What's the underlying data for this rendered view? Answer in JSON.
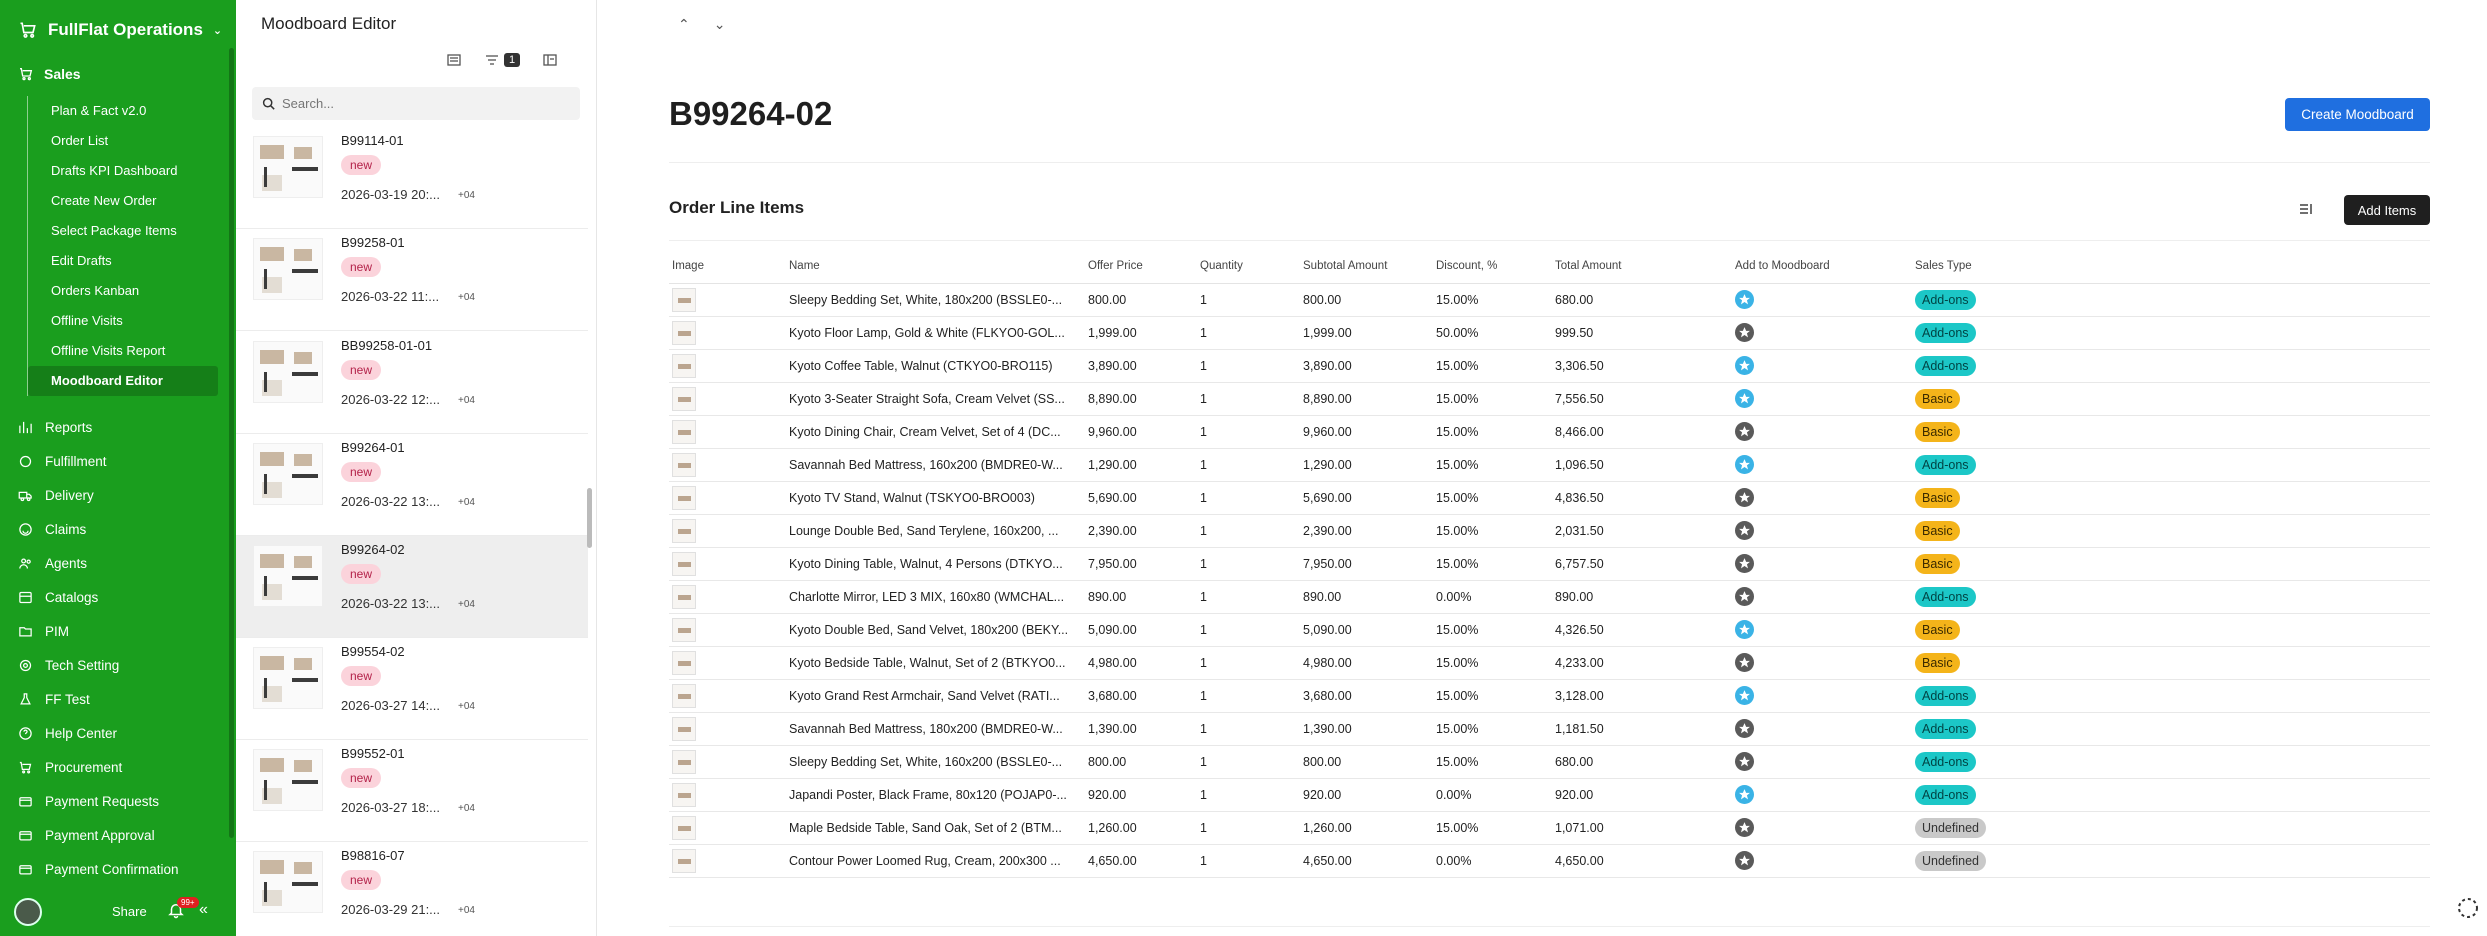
{
  "app": {
    "name": "FullFlat Operations",
    "section": "Sales",
    "share_label": "Share",
    "notif_count": "99+"
  },
  "sidebar": {
    "sales_items": [
      {
        "label": "Plan & Fact v2.0"
      },
      {
        "label": "Order List"
      },
      {
        "label": "Drafts KPI Dashboard"
      },
      {
        "label": "Create New Order"
      },
      {
        "label": "Select Package Items"
      },
      {
        "label": "Edit Drafts"
      },
      {
        "label": "Orders Kanban"
      },
      {
        "label": "Offline Visits"
      },
      {
        "label": "Offline Visits Report"
      },
      {
        "label": "Moodboard Editor"
      }
    ],
    "main_items": [
      {
        "label": "Reports",
        "icon": "chart-icon"
      },
      {
        "label": "Fulfillment",
        "icon": "circle-icon"
      },
      {
        "label": "Delivery",
        "icon": "truck-icon"
      },
      {
        "label": "Claims",
        "icon": "smile-icon"
      },
      {
        "label": "Agents",
        "icon": "users-icon"
      },
      {
        "label": "Catalogs",
        "icon": "grid-icon"
      },
      {
        "label": "PIM",
        "icon": "folder-icon"
      },
      {
        "label": "Tech Setting",
        "icon": "gear-icon"
      },
      {
        "label": "FF Test",
        "icon": "flask-icon"
      },
      {
        "label": "Help Center",
        "icon": "help-icon"
      },
      {
        "label": "Procurement",
        "icon": "cart-icon"
      },
      {
        "label": "Payment Requests",
        "icon": "payment-icon"
      },
      {
        "label": "Payment Approval",
        "icon": "payment-icon"
      },
      {
        "label": "Payment Confirmation",
        "icon": "payment-icon"
      }
    ]
  },
  "list_panel": {
    "title": "Moodboard Editor",
    "filter_count": "1",
    "search_placeholder": "Search...",
    "cards": [
      {
        "code": "B99114-01",
        "status": "new",
        "date": "2026-03-19 20:...",
        "tz": "+04"
      },
      {
        "code": "B99258-01",
        "status": "new",
        "date": "2026-03-22 11:...",
        "tz": "+04"
      },
      {
        "code": "BB99258-01-01",
        "status": "new",
        "date": "2026-03-22 12:...",
        "tz": "+04"
      },
      {
        "code": "B99264-01",
        "status": "new",
        "date": "2026-03-22 13:...",
        "tz": "+04"
      },
      {
        "code": "B99264-02",
        "status": "new",
        "date": "2026-03-22 13:...",
        "tz": "+04"
      },
      {
        "code": "B99554-02",
        "status": "new",
        "date": "2026-03-27 14:...",
        "tz": "+04"
      },
      {
        "code": "B99552-01",
        "status": "new",
        "date": "2026-03-27 18:...",
        "tz": "+04"
      },
      {
        "code": "B98816-07",
        "status": "new",
        "date": "2026-03-29 21:...",
        "tz": "+04"
      }
    ]
  },
  "main": {
    "title": "B99264-02",
    "create_button": "Create Moodboard",
    "section_title": "Order Line Items",
    "add_button": "Add Items",
    "columns": [
      "Image",
      "Name",
      "Offer Price",
      "Quantity",
      "Subtotal Amount",
      "Discount, %",
      "Total Amount",
      "Add to Moodboard",
      "Sales Type"
    ],
    "rows": [
      {
        "name": "Sleepy Bedding Set, White, 180x200 (BSSLE0-...",
        "price": "800.00",
        "qty": "1",
        "subtotal": "800.00",
        "discount": "15.00%",
        "total": "680.00",
        "moodboard": true,
        "type": "Add-ons"
      },
      {
        "name": "Kyoto Floor Lamp, Gold & White (FLKYO0-GOL...",
        "price": "1,999.00",
        "qty": "1",
        "subtotal": "1,999.00",
        "discount": "50.00%",
        "total": "999.50",
        "moodboard": false,
        "type": "Add-ons"
      },
      {
        "name": "Kyoto Coffee Table, Walnut (CTKYO0-BRO115)",
        "price": "3,890.00",
        "qty": "1",
        "subtotal": "3,890.00",
        "discount": "15.00%",
        "total": "3,306.50",
        "moodboard": true,
        "type": "Add-ons"
      },
      {
        "name": "Kyoto 3-Seater Straight Sofa, Cream Velvet (SS...",
        "price": "8,890.00",
        "qty": "1",
        "subtotal": "8,890.00",
        "discount": "15.00%",
        "total": "7,556.50",
        "moodboard": true,
        "type": "Basic"
      },
      {
        "name": "Kyoto Dining Chair, Cream Velvet, Set of 4 (DC...",
        "price": "9,960.00",
        "qty": "1",
        "subtotal": "9,960.00",
        "discount": "15.00%",
        "total": "8,466.00",
        "moodboard": false,
        "type": "Basic"
      },
      {
        "name": "Savannah Bed Mattress, 160x200 (BMDRE0-W...",
        "price": "1,290.00",
        "qty": "1",
        "subtotal": "1,290.00",
        "discount": "15.00%",
        "total": "1,096.50",
        "moodboard": true,
        "type": "Add-ons"
      },
      {
        "name": "Kyoto TV Stand, Walnut (TSKYO0-BRO003)",
        "price": "5,690.00",
        "qty": "1",
        "subtotal": "5,690.00",
        "discount": "15.00%",
        "total": "4,836.50",
        "moodboard": false,
        "type": "Basic"
      },
      {
        "name": "Lounge Double Bed, Sand Terylene, 160x200, ...",
        "price": "2,390.00",
        "qty": "1",
        "subtotal": "2,390.00",
        "discount": "15.00%",
        "total": "2,031.50",
        "moodboard": false,
        "type": "Basic"
      },
      {
        "name": "Kyoto Dining Table, Walnut, 4 Persons (DTKYO...",
        "price": "7,950.00",
        "qty": "1",
        "subtotal": "7,950.00",
        "discount": "15.00%",
        "total": "6,757.50",
        "moodboard": false,
        "type": "Basic"
      },
      {
        "name": "Charlotte Mirror, LED 3 MIX, 160x80 (WMCHAL...",
        "price": "890.00",
        "qty": "1",
        "subtotal": "890.00",
        "discount": "0.00%",
        "total": "890.00",
        "moodboard": false,
        "type": "Add-ons"
      },
      {
        "name": "Kyoto Double Bed, Sand Velvet, 180x200 (BEKY...",
        "price": "5,090.00",
        "qty": "1",
        "subtotal": "5,090.00",
        "discount": "15.00%",
        "total": "4,326.50",
        "moodboard": true,
        "type": "Basic"
      },
      {
        "name": "Kyoto Bedside Table, Walnut, Set of 2 (BTKYO0...",
        "price": "4,980.00",
        "qty": "1",
        "subtotal": "4,980.00",
        "discount": "15.00%",
        "total": "4,233.00",
        "moodboard": false,
        "type": "Basic"
      },
      {
        "name": "Kyoto Grand Rest Armchair, Sand Velvet (RATI...",
        "price": "3,680.00",
        "qty": "1",
        "subtotal": "3,680.00",
        "discount": "15.00%",
        "total": "3,128.00",
        "moodboard": true,
        "type": "Add-ons"
      },
      {
        "name": "Savannah Bed Mattress, 180x200 (BMDRE0-W...",
        "price": "1,390.00",
        "qty": "1",
        "subtotal": "1,390.00",
        "discount": "15.00%",
        "total": "1,181.50",
        "moodboard": false,
        "type": "Add-ons"
      },
      {
        "name": "Sleepy Bedding Set, White, 160x200 (BSSLE0-...",
        "price": "800.00",
        "qty": "1",
        "subtotal": "800.00",
        "discount": "15.00%",
        "total": "680.00",
        "moodboard": false,
        "type": "Add-ons"
      },
      {
        "name": "Japandi Poster, Black Frame, 80x120 (POJAP0-...",
        "price": "920.00",
        "qty": "1",
        "subtotal": "920.00",
        "discount": "0.00%",
        "total": "920.00",
        "moodboard": true,
        "type": "Add-ons"
      },
      {
        "name": "Maple Bedside Table, Sand Oak, Set of 2 (BTM...",
        "price": "1,260.00",
        "qty": "1",
        "subtotal": "1,260.00",
        "discount": "15.00%",
        "total": "1,071.00",
        "moodboard": false,
        "type": "Undefined"
      },
      {
        "name": "Contour Power Loomed Rug, Cream, 200x300 ...",
        "price": "4,650.00",
        "qty": "1",
        "subtotal": "4,650.00",
        "discount": "0.00%",
        "total": "4,650.00",
        "moodboard": false,
        "type": "Undefined"
      }
    ]
  },
  "colors": {
    "sidebar_bg": "#1a9e1e",
    "primary": "#1f6fe0",
    "moodboard_on": "#3ab3e6",
    "addons": "#1cc7c7",
    "basic": "#f4b41a",
    "undefined": "#c9c9c9"
  }
}
